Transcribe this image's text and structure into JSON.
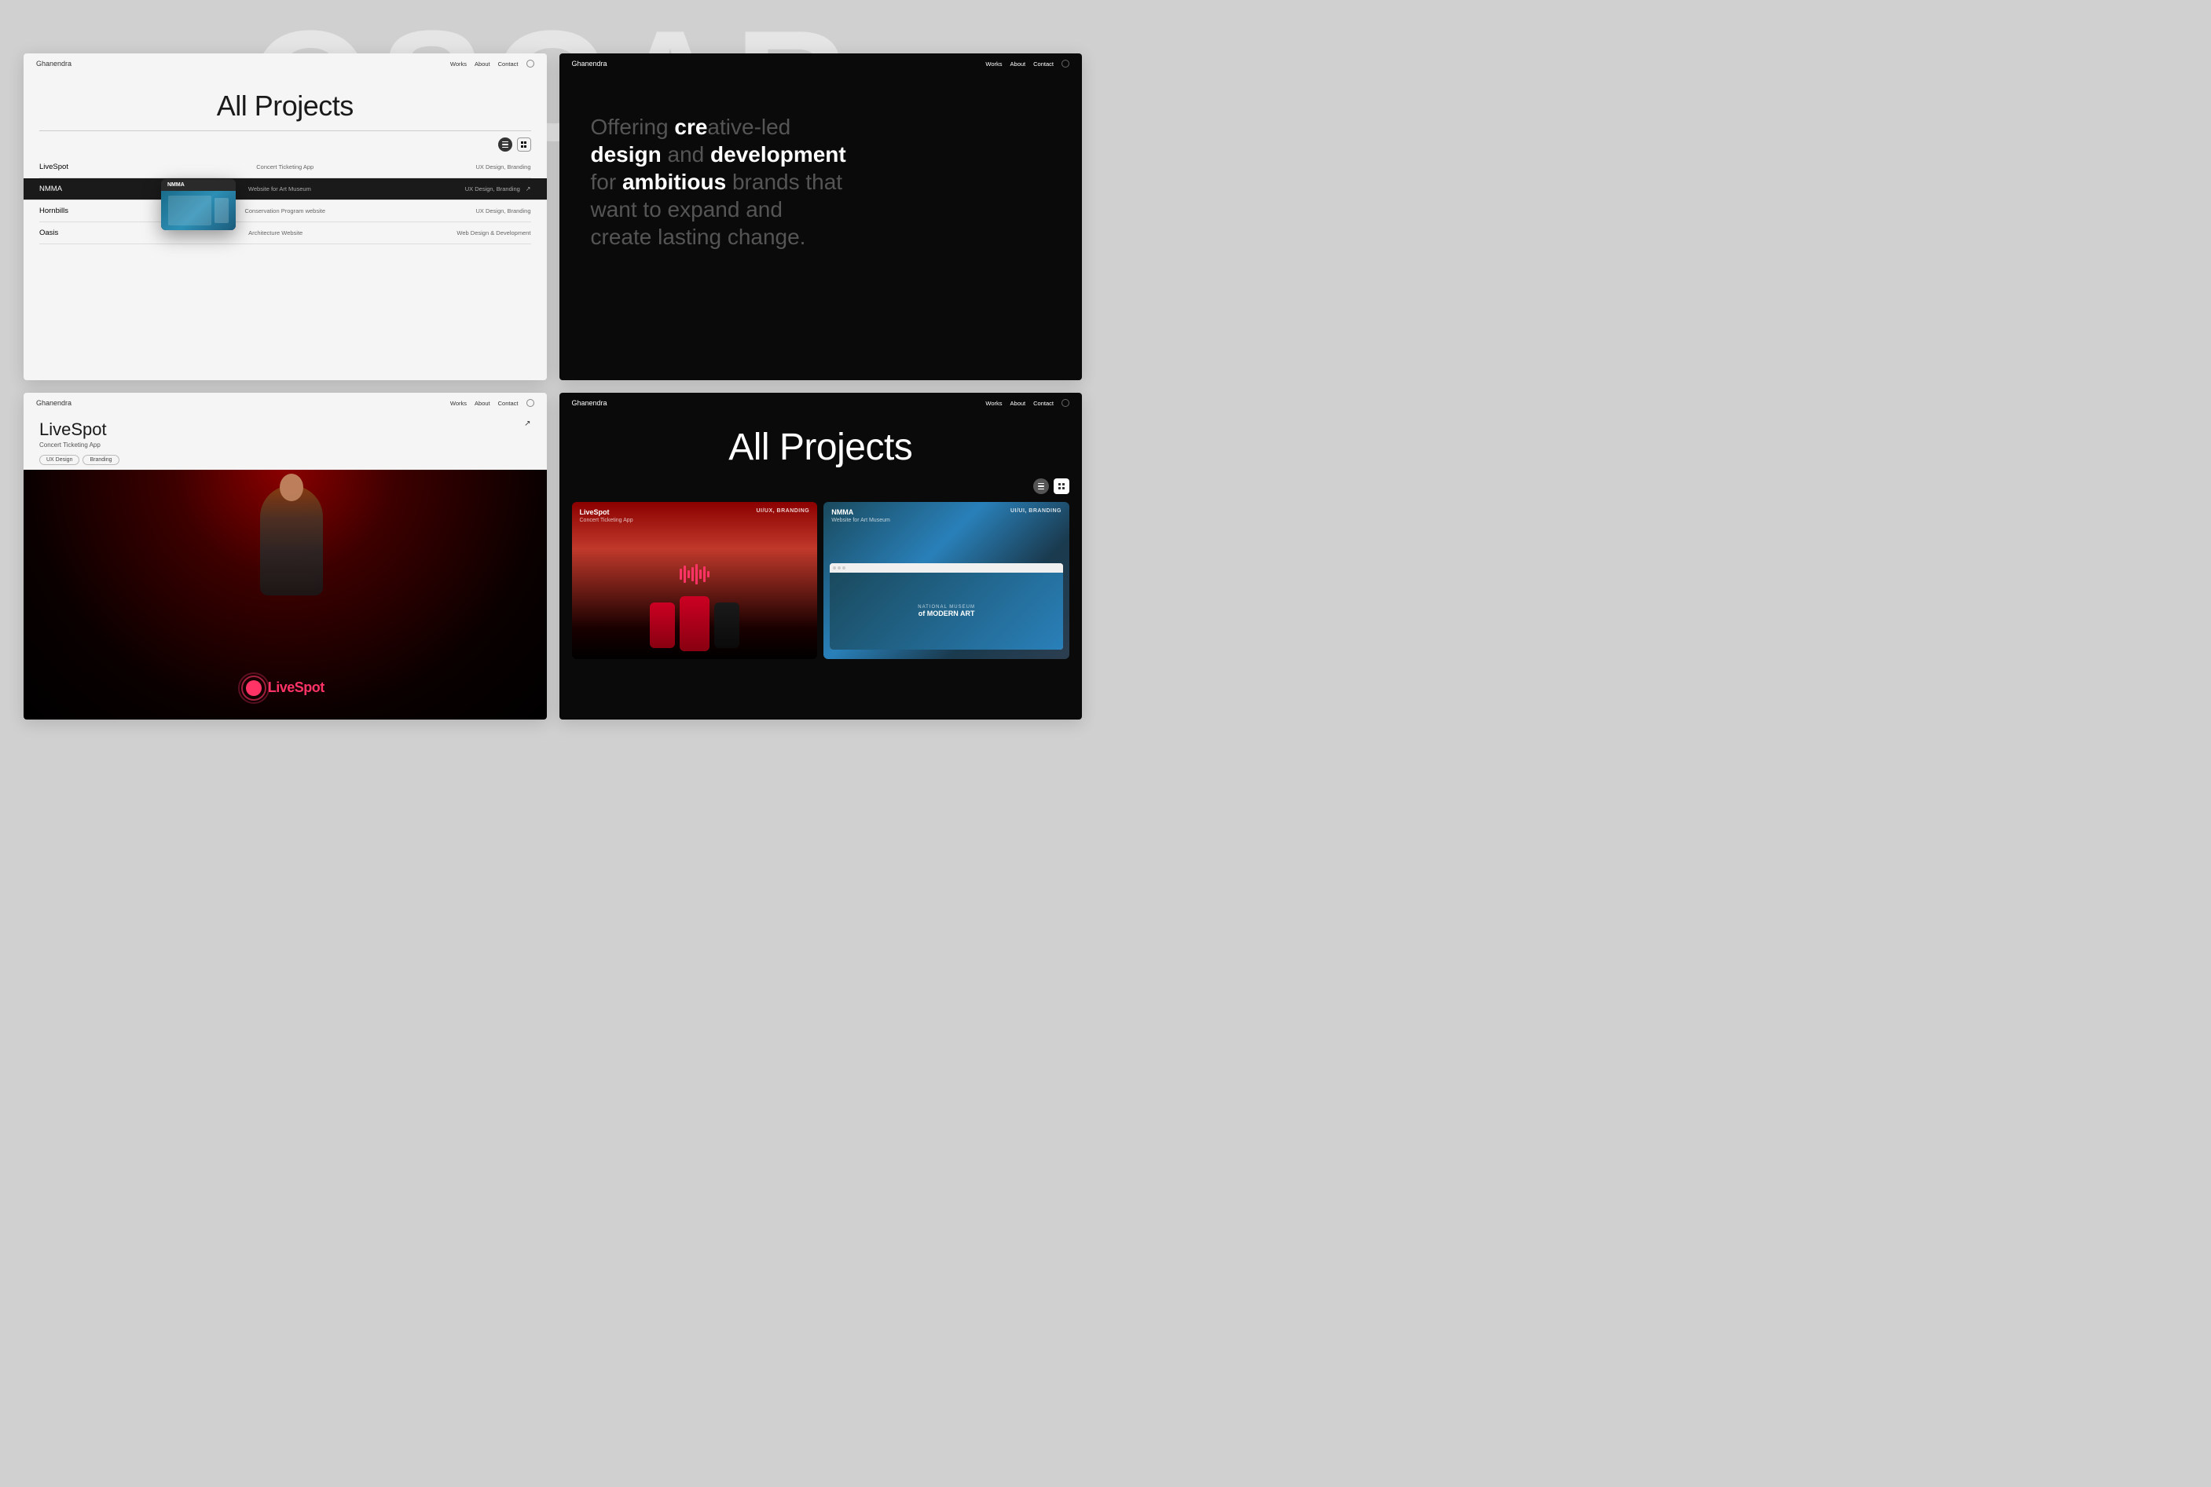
{
  "watermark": {
    "text": "OSCAR"
  },
  "panel1": {
    "nav": {
      "brand": "Ghanendra",
      "links": [
        "Works",
        "About",
        "Contact"
      ],
      "theme_icon": "moon"
    },
    "hero_title": "All Projects",
    "view_list": "list-icon",
    "view_grid": "grid-icon",
    "projects": [
      {
        "name": "LiveSpot",
        "desc": "Concert Ticketing App",
        "tags": "UX Design, Branding",
        "active": false
      },
      {
        "name": "NMMA",
        "desc": "Website for Art Museum",
        "tags": "UX Design, Branding",
        "active": true
      },
      {
        "name": "Hornbills",
        "desc": "Conservation Program website",
        "tags": "UX Design, Branding",
        "active": false
      },
      {
        "name": "Oasis",
        "desc": "Architecture Website",
        "tags": "Web Design & Development",
        "active": false
      }
    ],
    "tooltip": {
      "label": "NMMA"
    }
  },
  "panel2": {
    "nav": {
      "brand": "Ghanendra",
      "links": [
        "Works",
        "About",
        "Contact"
      ],
      "theme_icon": "settings"
    },
    "hero": {
      "text_parts": [
        {
          "text": "Offering ",
          "bold": false
        },
        {
          "text": "cre",
          "bold": false
        },
        {
          "text": "ative-led",
          "bold": false
        },
        {
          "text": " design and",
          "bold": false
        },
        {
          "text": " development",
          "bold": false
        },
        {
          "text": " for ",
          "bold": false
        },
        {
          "text": "ambitious",
          "bold": true
        },
        {
          "text": " brands that want to expand and create lasting change.",
          "bold": false
        }
      ],
      "full_text": "Offering creative-led design and development for ambitious brands that want to expand and create lasting change."
    }
  },
  "panel3": {
    "nav": {
      "brand": "Ghanendra",
      "links": [
        "Works",
        "About",
        "Contact"
      ],
      "theme_icon": "moon"
    },
    "project": {
      "title": "LiveSpot",
      "subtitle": "Concert Ticketing App",
      "tags": [
        "UX Design",
        "Branding"
      ],
      "ext_link": "↗"
    }
  },
  "panel4": {
    "nav": {
      "brand": "Ghanendra",
      "links": [
        "Works",
        "About",
        "Contact"
      ],
      "theme_icon": "settings"
    },
    "hero_title": "All Projects",
    "projects": [
      {
        "name": "LiveSpot",
        "subtitle": "Concert Ticketing App",
        "tags": "UI/UX, BRANDING",
        "theme": "red"
      },
      {
        "name": "NMMA",
        "subtitle": "Website for Art Museum",
        "tags": "UI/UI, BRANDING",
        "theme": "blue"
      }
    ]
  }
}
